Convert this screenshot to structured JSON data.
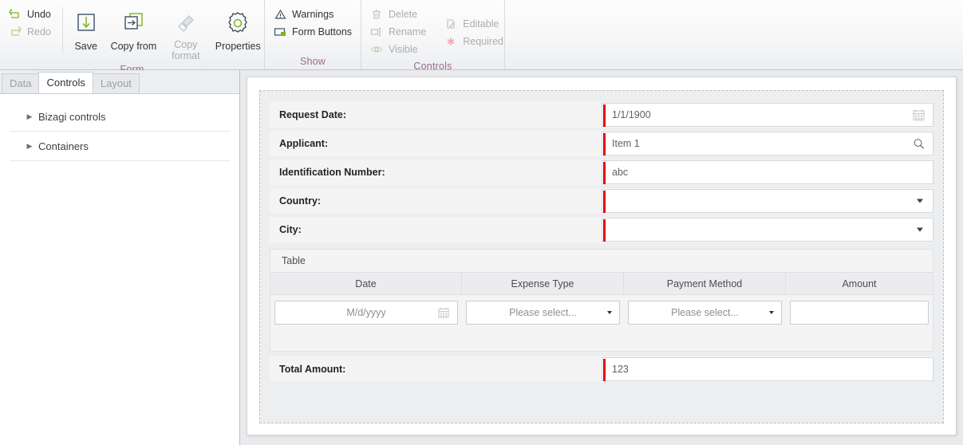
{
  "ribbon": {
    "groups": [
      {
        "name": "form",
        "label": "Form",
        "small_commands": [
          {
            "label": "Undo",
            "icon": "undo-icon",
            "enabled": true
          },
          {
            "label": "Redo",
            "icon": "redo-icon",
            "enabled": false
          }
        ],
        "big_buttons": [
          {
            "label": "Save",
            "icon": "save-icon",
            "enabled": true
          },
          {
            "label": "Copy from",
            "icon": "copy-from-icon",
            "enabled": true
          },
          {
            "label": "Copy format",
            "icon": "copy-format-icon",
            "enabled": false
          },
          {
            "label": "Properties",
            "icon": "properties-gear-icon",
            "enabled": true
          }
        ]
      },
      {
        "name": "show",
        "label": "Show",
        "small_commands": [
          {
            "label": "Warnings",
            "icon": "warning-triangle-icon",
            "enabled": true
          },
          {
            "label": "Form Buttons",
            "icon": "form-buttons-icon",
            "enabled": true
          }
        ]
      },
      {
        "name": "controls",
        "label": "Controls",
        "column_one": [
          {
            "label": "Delete",
            "icon": "trash-icon",
            "enabled": false
          },
          {
            "label": "Rename",
            "icon": "rename-icon",
            "enabled": false
          },
          {
            "label": "Visible",
            "icon": "eye-icon",
            "enabled": false
          }
        ],
        "column_two": [
          {
            "label": "Editable",
            "icon": "editable-page-icon",
            "enabled": false
          },
          {
            "label": "Required",
            "icon": "required-asterisk-icon",
            "enabled": false
          }
        ]
      }
    ]
  },
  "sidebar": {
    "tabs": [
      {
        "label": "Data",
        "active": false
      },
      {
        "label": "Controls",
        "active": true
      },
      {
        "label": "Layout",
        "active": false
      }
    ],
    "tree_items": [
      {
        "label": "Bizagi controls",
        "icon": "chevron-right-icon",
        "expanded": false
      },
      {
        "label": "Containers",
        "icon": "chevron-right-icon",
        "expanded": false
      }
    ]
  },
  "form": {
    "fields": [
      {
        "label": "Request Date:",
        "value": "1/1/1900",
        "type": "date",
        "required": true,
        "icon": "calendar-icon"
      },
      {
        "label": "Applicant:",
        "value": "Item 1",
        "type": "search",
        "required": true,
        "icon": "search-icon"
      },
      {
        "label": "Identification Number:",
        "value": "abc",
        "type": "text",
        "required": true,
        "icon": ""
      },
      {
        "label": "Country:",
        "value": "",
        "type": "dropdown",
        "required": true,
        "icon": "chevron-down-icon"
      },
      {
        "label": "City:",
        "value": "",
        "type": "dropdown",
        "required": true,
        "icon": "chevron-down-icon"
      }
    ],
    "table": {
      "title": "Table",
      "columns": [
        "Date",
        "Expense Type",
        "Payment Method",
        "Amount"
      ],
      "row": {
        "date_placeholder": "M/d/yyyy",
        "date_icon": "calendar-icon",
        "expense_type_value": "Please select...",
        "payment_method_value": "Please select...",
        "amount_value": ""
      }
    },
    "total": {
      "label": "Total Amount:",
      "value": "123",
      "required": true
    }
  },
  "colors": {
    "required_red": "#e8000d",
    "group_label": "#9b6b8c",
    "accent_green": "#7ab51d",
    "icon_navy": "#3e5060"
  }
}
